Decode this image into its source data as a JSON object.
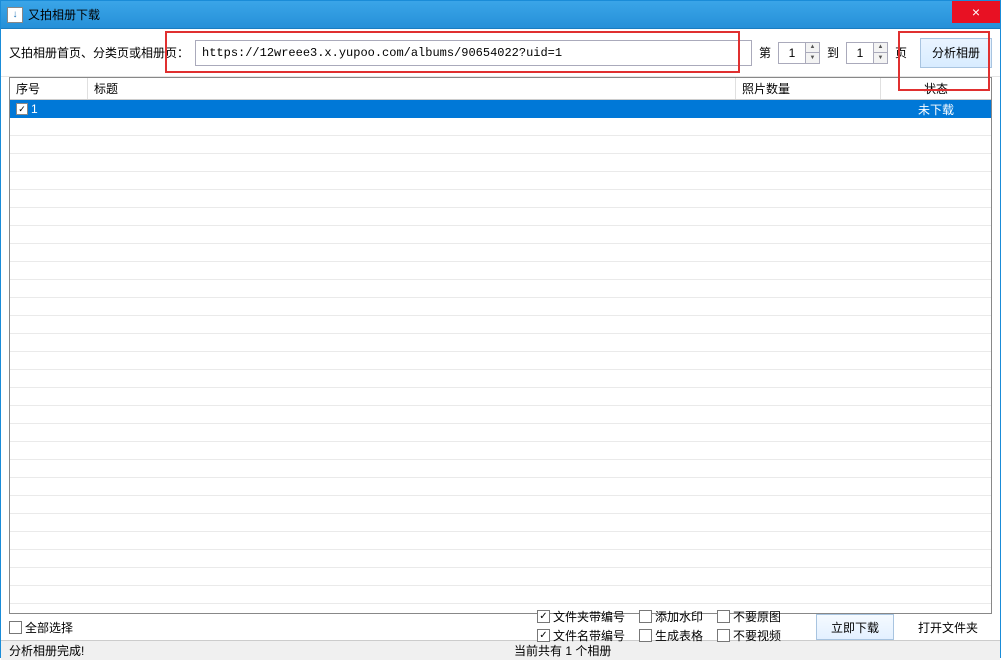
{
  "window": {
    "title": "又拍相册下载",
    "close_icon": "×"
  },
  "toolbar": {
    "url_label": "又拍相册首页、分类页或相册页：",
    "url_value": "https://12wreee3.x.yupoo.com/albums/90654022?uid=1",
    "page_from_label": "第",
    "page_from": "1",
    "page_to_label": "到",
    "page_to": "1",
    "page_unit": "页",
    "analyze": "分析相册"
  },
  "table": {
    "headers": {
      "seq": "序号",
      "title": "标题",
      "count": "照片数量",
      "status": "状态"
    },
    "rows": [
      {
        "checked": true,
        "seq": "1",
        "title": "",
        "count": "",
        "status": "未下载"
      }
    ]
  },
  "bottom": {
    "select_all": "全部选择",
    "opts": {
      "folder_num": "文件夹带编号",
      "file_num": "文件名带编号",
      "watermark": "添加水印",
      "gen_table": "生成表格",
      "no_original": "不要原图",
      "no_video": "不要视频"
    },
    "checked": {
      "folder_num": true,
      "file_num": true,
      "watermark": false,
      "gen_table": false,
      "no_original": false,
      "no_video": false
    },
    "download": "立即下载",
    "open_folder": "打开文件夹"
  },
  "status": {
    "left": "分析相册完成!",
    "mid": "当前共有 1 个相册"
  }
}
